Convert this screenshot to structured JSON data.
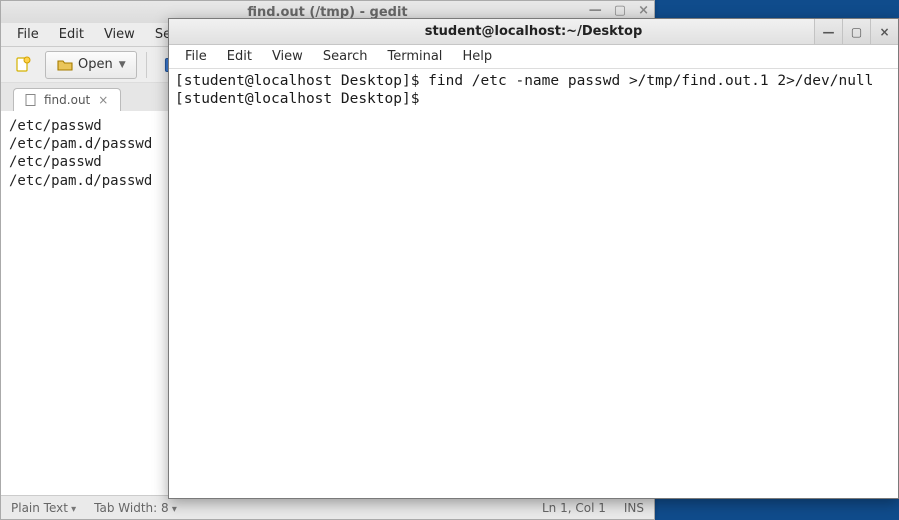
{
  "gedit": {
    "title": "find.out (/tmp) - gedit",
    "menubar": [
      "File",
      "Edit",
      "View",
      "Sea"
    ],
    "toolbar": {
      "open_label": "Open"
    },
    "tab": {
      "name": "find.out"
    },
    "wincontrols": {
      "min": "—",
      "max": "▢",
      "close": "×"
    },
    "content_lines": [
      "/etc/passwd",
      "/etc/pam.d/passwd",
      "/etc/passwd",
      "/etc/pam.d/passwd"
    ],
    "status": {
      "syntax": "Plain Text",
      "tabwidth": "Tab Width: 8",
      "pos": "Ln 1, Col 1",
      "ins": "INS"
    }
  },
  "terminal": {
    "title": "student@localhost:~/Desktop",
    "menubar": [
      "File",
      "Edit",
      "View",
      "Search",
      "Terminal",
      "Help"
    ],
    "wincontrols": {
      "min": "—",
      "max": "▢",
      "close": "×"
    },
    "lines": [
      "[student@localhost Desktop]$ find /etc -name passwd >/tmp/find.out.1 2>/dev/null",
      "[student@localhost Desktop]$ "
    ]
  }
}
